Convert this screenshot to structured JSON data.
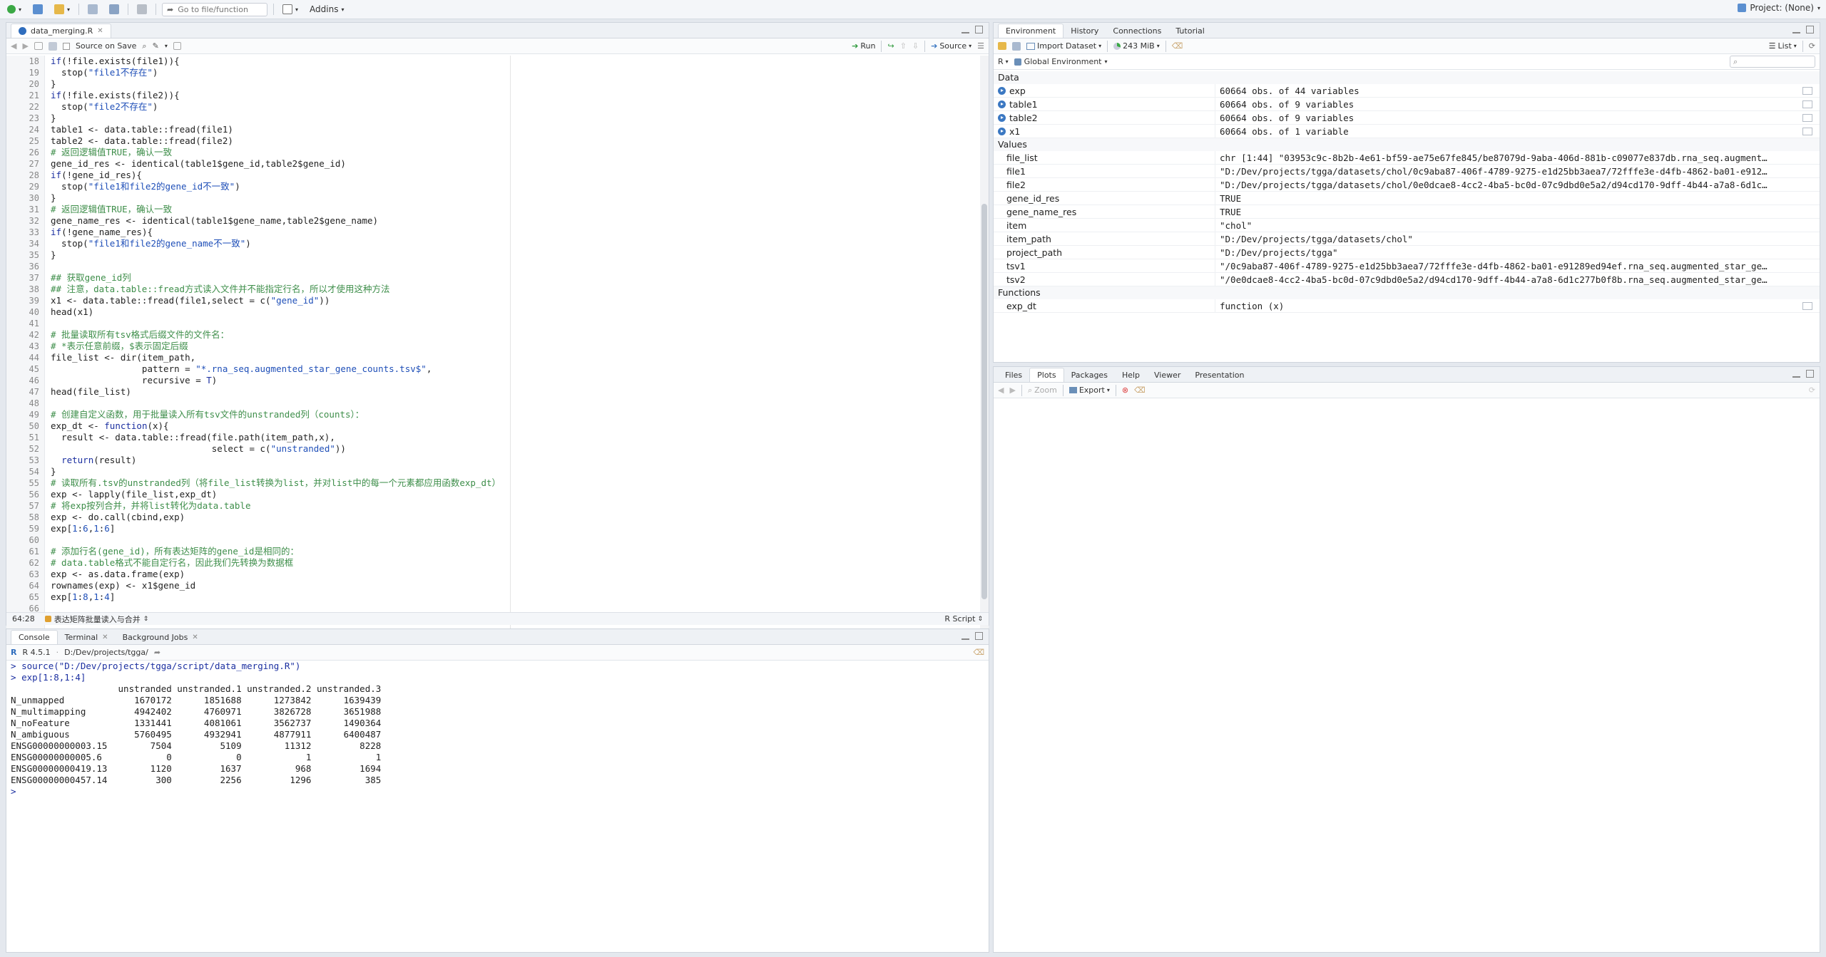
{
  "global_toolbar": {
    "go_to_file_placeholder": "Go to file/function",
    "addins_label": "Addins",
    "project_label": "Project: (None)"
  },
  "editor": {
    "tab_name": "data_merging.R",
    "source_on_save_label": "Source on Save",
    "run_label": "Run",
    "source_label": "Source",
    "status_position": "64:28",
    "status_section": "表达矩阵批量读入与合并",
    "status_filetype": "R Script",
    "lines": [
      {
        "n": "18",
        "html": "<span class=\"c-kw\">if</span>(!file.exists(file1)){"
      },
      {
        "n": "19",
        "html": "  stop(<span class=\"c-str\">\"file1不存在\"</span>)"
      },
      {
        "n": "20",
        "html": "}"
      },
      {
        "n": "21",
        "html": "<span class=\"c-kw\">if</span>(!file.exists(file2)){"
      },
      {
        "n": "22",
        "html": "  stop(<span class=\"c-str\">\"file2不存在\"</span>)"
      },
      {
        "n": "23",
        "html": "}"
      },
      {
        "n": "24",
        "html": "table1 &lt;- data.table::fread(file1)"
      },
      {
        "n": "25",
        "html": "table2 &lt;- data.table::fread(file2)"
      },
      {
        "n": "26",
        "html": "<span class=\"c-comment\"># 返回逻辑值TRUE，确认一致</span>"
      },
      {
        "n": "27",
        "html": "gene_id_res &lt;- identical(table1$gene_id,table2$gene_id)"
      },
      {
        "n": "28",
        "html": "<span class=\"c-kw\">if</span>(!gene_id_res){"
      },
      {
        "n": "29",
        "html": "  stop(<span class=\"c-str\">\"file1和file2的gene_id不一致\"</span>)"
      },
      {
        "n": "30",
        "html": "}"
      },
      {
        "n": "31",
        "html": "<span class=\"c-comment\"># 返回逻辑值TRUE，确认一致</span>"
      },
      {
        "n": "32",
        "html": "gene_name_res &lt;- identical(table1$gene_name,table2$gene_name)"
      },
      {
        "n": "33",
        "html": "<span class=\"c-kw\">if</span>(!gene_name_res){"
      },
      {
        "n": "34",
        "html": "  stop(<span class=\"c-str\">\"file1和file2的gene_name不一致\"</span>)"
      },
      {
        "n": "35",
        "html": "}"
      },
      {
        "n": "36",
        "html": ""
      },
      {
        "n": "37",
        "html": "<span class=\"c-comment\">## 获取gene_id列</span>"
      },
      {
        "n": "38",
        "html": "<span class=\"c-comment\">## 注意，data.table::fread方式读入文件并不能指定行名，所以才使用这种方法</span>"
      },
      {
        "n": "39",
        "html": "x1 &lt;- data.table::fread(file1,select = c(<span class=\"c-str\">\"gene_id\"</span>))"
      },
      {
        "n": "40",
        "html": "head(x1)"
      },
      {
        "n": "41",
        "html": ""
      },
      {
        "n": "42",
        "html": "<span class=\"c-comment\"># 批量读取所有tsv格式后缀文件的文件名：</span>"
      },
      {
        "n": "43",
        "html": "<span class=\"c-comment\"># *表示任意前缀，$表示固定后缀</span>"
      },
      {
        "n": "44",
        "html": "file_list &lt;- dir(item_path,"
      },
      {
        "n": "45",
        "html": "                 pattern = <span class=\"c-str\">\"*.rna_seq.augmented_star_gene_counts.tsv$\"</span>,"
      },
      {
        "n": "46",
        "html": "                 recursive = <span class=\"c-kw\">T</span>)"
      },
      {
        "n": "47",
        "html": "head(file_list)"
      },
      {
        "n": "48",
        "html": ""
      },
      {
        "n": "49",
        "html": "<span class=\"c-comment\"># 创建自定义函数，用于批量读入所有tsv文件的unstranded列（counts）：</span>"
      },
      {
        "n": "50",
        "html": "exp_dt &lt;- <span class=\"c-kw\">function</span>(x){"
      },
      {
        "n": "51",
        "html": "  result &lt;- data.table::fread(file.path(item_path,x),"
      },
      {
        "n": "52",
        "html": "                              select = c(<span class=\"c-str\">\"unstranded\"</span>))"
      },
      {
        "n": "53",
        "html": "  <span class=\"c-kw\">return</span>(result)"
      },
      {
        "n": "54",
        "html": "}"
      },
      {
        "n": "55",
        "html": "<span class=\"c-comment\"># 读取所有.tsv的unstranded列（将file_list转换为list，并对list中的每一个元素都应用函数exp_dt）</span>"
      },
      {
        "n": "56",
        "html": "exp &lt;- lapply(file_list,exp_dt)"
      },
      {
        "n": "57",
        "html": "<span class=\"c-comment\"># 将exp按列合并，并将list转化为data.table</span>"
      },
      {
        "n": "58",
        "html": "exp &lt;- do.call(cbind,exp)"
      },
      {
        "n": "59",
        "html": "exp[<span class=\"c-num\">1</span>:<span class=\"c-num\">6</span>,<span class=\"c-num\">1</span>:<span class=\"c-num\">6</span>]"
      },
      {
        "n": "60",
        "html": ""
      },
      {
        "n": "61",
        "html": "<span class=\"c-comment\"># 添加行名(gene_id)，所有表达矩阵的gene_id是相同的：</span>"
      },
      {
        "n": "62",
        "html": "<span class=\"c-comment\"># data.table格式不能自定行名，因此我们先转换为数据框</span>"
      },
      {
        "n": "63",
        "html": "exp &lt;- as.data.frame(exp)"
      },
      {
        "n": "64",
        "html": "rownames(exp) &lt;- x1$gene_id"
      },
      {
        "n": "65",
        "html": "exp[<span class=\"c-num\">1</span>:<span class=\"c-num\">8</span>,<span class=\"c-num\">1</span>:<span class=\"c-num\">4</span>]"
      },
      {
        "n": "66",
        "html": ""
      }
    ]
  },
  "console": {
    "tabs": [
      "Console",
      "Terminal",
      "Background Jobs"
    ],
    "r_version": "R 4.5.1",
    "working_dir": "D:/Dev/projects/tgga/",
    "lines": [
      {
        "type": "cmd",
        "text": "source(\"D:/Dev/projects/tgga/script/data_merging.R\")"
      },
      {
        "type": "cmd",
        "text": "exp[1:8,1:4]"
      },
      {
        "type": "out",
        "text": "                    unstranded unstranded.1 unstranded.2 unstranded.3"
      },
      {
        "type": "out",
        "text": "N_unmapped             1670172      1851688      1273842      1639439"
      },
      {
        "type": "out",
        "text": "N_multimapping         4942402      4760971      3826728      3651988"
      },
      {
        "type": "out",
        "text": "N_noFeature            1331441      4081061      3562737      1490364"
      },
      {
        "type": "out",
        "text": "N_ambiguous            5760495      4932941      4877911      6400487"
      },
      {
        "type": "out",
        "text": "ENSG00000000003.15        7504         5109        11312         8228"
      },
      {
        "type": "out",
        "text": "ENSG00000000005.6            0            0            1            1"
      },
      {
        "type": "out",
        "text": "ENSG00000000419.13        1120         1637          968         1694"
      },
      {
        "type": "out",
        "text": "ENSG00000000457.14         300         2256         1296          385"
      },
      {
        "type": "prompt",
        "text": ""
      }
    ]
  },
  "environment": {
    "tabs": [
      "Environment",
      "History",
      "Connections",
      "Tutorial"
    ],
    "import_dataset_label": "Import Dataset",
    "memory_label": "243 MiB",
    "list_label": "List",
    "language": "R",
    "scope": "Global Environment",
    "data_header": "Data",
    "values_header": "Values",
    "functions_header": "Functions",
    "data": [
      {
        "name": "exp",
        "value": "60664 obs. of 44 variables"
      },
      {
        "name": "table1",
        "value": "60664 obs. of 9 variables"
      },
      {
        "name": "table2",
        "value": "60664 obs. of 9 variables"
      },
      {
        "name": "x1",
        "value": "60664 obs. of 1 variable"
      }
    ],
    "values": [
      {
        "name": "file_list",
        "value": "chr [1:44] \"03953c9c-8b2b-4e61-bf59-ae75e67fe845/be87079d-9aba-406d-881b-c09077e837db.rna_seq.augment…"
      },
      {
        "name": "file1",
        "value": "\"D:/Dev/projects/tgga/datasets/chol/0c9aba87-406f-4789-9275-e1d25bb3aea7/72fffe3e-d4fb-4862-ba01-e912…"
      },
      {
        "name": "file2",
        "value": "\"D:/Dev/projects/tgga/datasets/chol/0e0dcae8-4cc2-4ba5-bc0d-07c9dbd0e5a2/d94cd170-9dff-4b44-a7a8-6d1c…"
      },
      {
        "name": "gene_id_res",
        "value": "TRUE"
      },
      {
        "name": "gene_name_res",
        "value": "TRUE"
      },
      {
        "name": "item",
        "value": "\"chol\""
      },
      {
        "name": "item_path",
        "value": "\"D:/Dev/projects/tgga/datasets/chol\""
      },
      {
        "name": "project_path",
        "value": "\"D:/Dev/projects/tgga\""
      },
      {
        "name": "tsv1",
        "value": "\"/0c9aba87-406f-4789-9275-e1d25bb3aea7/72fffe3e-d4fb-4862-ba01-e91289ed94ef.rna_seq.augmented_star_ge…"
      },
      {
        "name": "tsv2",
        "value": "\"/0e0dcae8-4cc2-4ba5-bc0d-07c9dbd0e5a2/d94cd170-9dff-4b44-a7a8-6d1c277b0f8b.rna_seq.augmented_star_ge…"
      }
    ],
    "functions": [
      {
        "name": "exp_dt",
        "value": "function (x)"
      }
    ]
  },
  "files_pane": {
    "tabs": [
      "Files",
      "Plots",
      "Packages",
      "Help",
      "Viewer",
      "Presentation"
    ],
    "active_tab": "Plots",
    "zoom_label": "Zoom",
    "export_label": "Export"
  }
}
